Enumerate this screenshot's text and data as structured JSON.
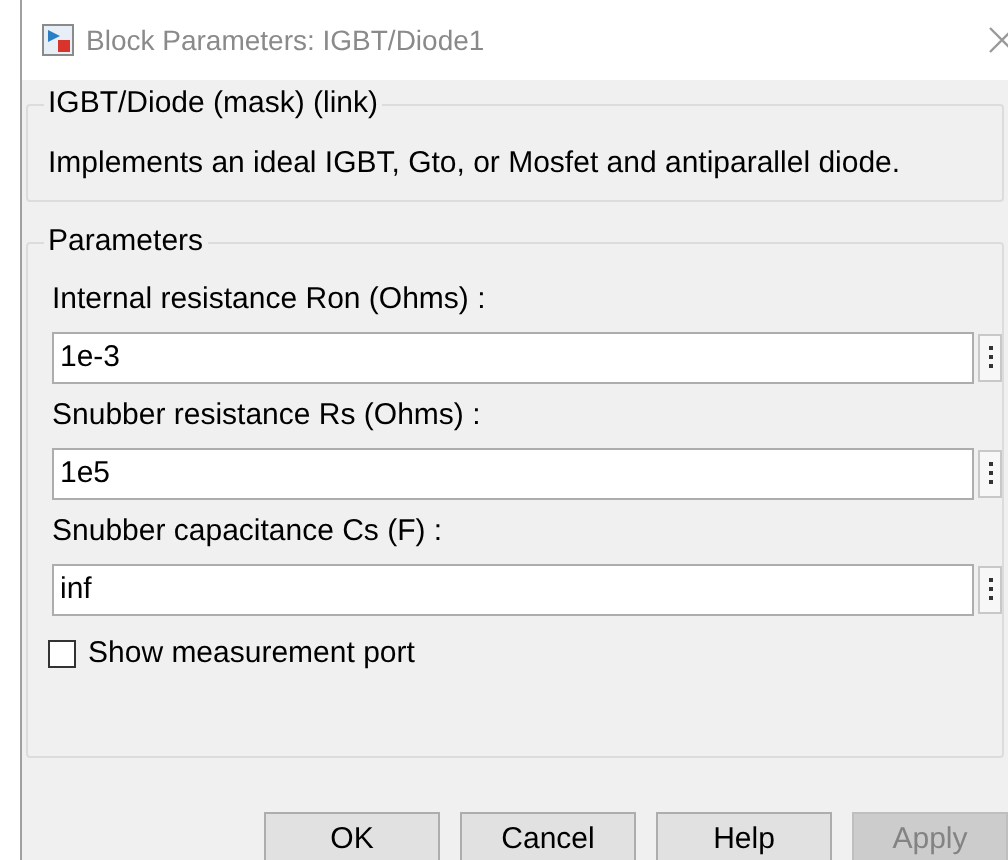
{
  "window": {
    "title": "Block Parameters: IGBT/Diode1"
  },
  "mask_group": {
    "title": "IGBT/Diode (mask) (link)",
    "description": "Implements an ideal  IGBT, Gto, or Mosfet and antiparallel diode."
  },
  "parameters_group": {
    "title": "Parameters",
    "fields": [
      {
        "label": "Internal resistance Ron (Ohms) :",
        "value": "1e-3"
      },
      {
        "label": "Snubber resistance Rs (Ohms) :",
        "value": "1e5"
      },
      {
        "label": "Snubber capacitance Cs (F) :",
        "value": "inf"
      }
    ],
    "checkbox": {
      "label": "Show measurement port",
      "checked": false
    }
  },
  "buttons": [
    {
      "label": "OK",
      "disabled": false
    },
    {
      "label": "Cancel",
      "disabled": false
    },
    {
      "label": "Help",
      "disabled": false
    },
    {
      "label": "Apply",
      "disabled": true
    }
  ]
}
